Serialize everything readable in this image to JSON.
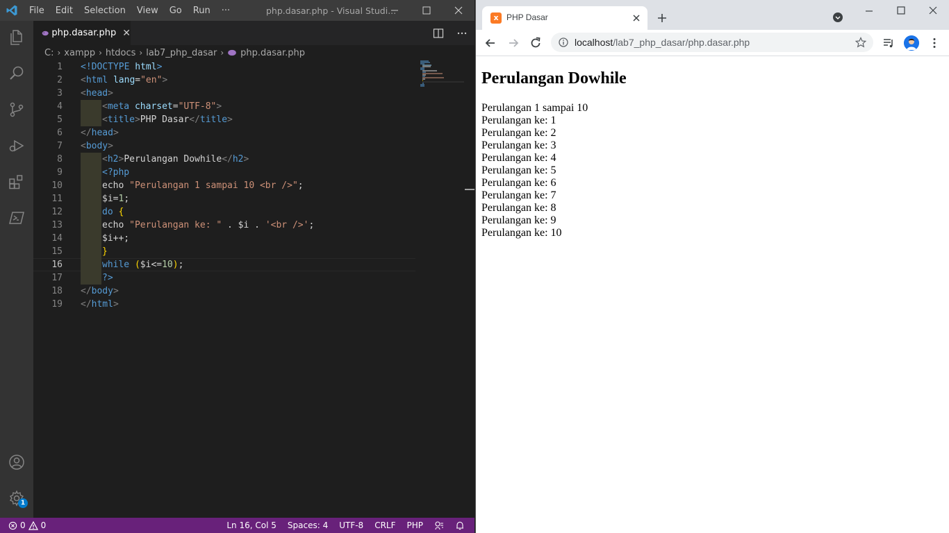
{
  "vscode": {
    "menu": [
      "File",
      "Edit",
      "Selection",
      "View",
      "Go",
      "Run",
      "···"
    ],
    "window_title": "php.dasar.php - Visual Studi...",
    "tab": {
      "label": "php.dasar.php",
      "close": "✕"
    },
    "breadcrumb": [
      "C:",
      "xampp",
      "htdocs",
      "lab7_php_dasar",
      "php.dasar.php"
    ],
    "active_line": 16,
    "settings_badge": "1",
    "status": {
      "errors": "0",
      "warnings": "0",
      "position": "Ln 16, Col 5",
      "spaces": "Spaces: 4",
      "encoding": "UTF-8",
      "eol": "CRLF",
      "language": "PHP"
    }
  },
  "code": [
    {
      "n": "1",
      "indent": 0,
      "tokens": [
        [
          "tag",
          "<!"
        ],
        [
          "tag",
          "DOCTYPE"
        ],
        [
          "plain",
          " "
        ],
        [
          "attr",
          "html"
        ],
        [
          "tag",
          ">"
        ]
      ]
    },
    {
      "n": "2",
      "indent": 0,
      "tokens": [
        [
          "gray",
          "<"
        ],
        [
          "tag",
          "html"
        ],
        [
          "plain",
          " "
        ],
        [
          "attr",
          "lang"
        ],
        [
          "plain",
          "="
        ],
        [
          "str",
          "\"en\""
        ],
        [
          "gray",
          ">"
        ]
      ]
    },
    {
      "n": "3",
      "indent": 0,
      "tokens": [
        [
          "gray",
          "<"
        ],
        [
          "tag",
          "head"
        ],
        [
          "gray",
          ">"
        ]
      ]
    },
    {
      "n": "4",
      "indent": 1,
      "tokens": [
        [
          "gray",
          "<"
        ],
        [
          "tag",
          "meta"
        ],
        [
          "plain",
          " "
        ],
        [
          "attr",
          "charset"
        ],
        [
          "plain",
          "="
        ],
        [
          "str",
          "\"UTF-8\""
        ],
        [
          "gray",
          ">"
        ]
      ]
    },
    {
      "n": "5",
      "indent": 1,
      "tokens": [
        [
          "gray",
          "<"
        ],
        [
          "tag",
          "title"
        ],
        [
          "gray",
          ">"
        ],
        [
          "plain",
          "PHP Dasar"
        ],
        [
          "gray",
          "</"
        ],
        [
          "tag",
          "title"
        ],
        [
          "gray",
          ">"
        ]
      ]
    },
    {
      "n": "6",
      "indent": 0,
      "tokens": [
        [
          "gray",
          "</"
        ],
        [
          "tag",
          "head"
        ],
        [
          "gray",
          ">"
        ]
      ]
    },
    {
      "n": "7",
      "indent": 0,
      "tokens": [
        [
          "gray",
          "<"
        ],
        [
          "tag",
          "body"
        ],
        [
          "gray",
          ">"
        ]
      ]
    },
    {
      "n": "8",
      "indent": 1,
      "tokens": [
        [
          "gray",
          "<"
        ],
        [
          "tag",
          "h2"
        ],
        [
          "gray",
          ">"
        ],
        [
          "plain",
          "Perulangan Dowhile"
        ],
        [
          "gray",
          "</"
        ],
        [
          "tag",
          "h2"
        ],
        [
          "gray",
          ">"
        ]
      ]
    },
    {
      "n": "9",
      "indent": 1,
      "tokens": [
        [
          "tag",
          "<?php"
        ]
      ]
    },
    {
      "n": "10",
      "indent": 1,
      "tokens": [
        [
          "plain",
          "echo "
        ],
        [
          "str",
          "\"Perulangan 1 sampai 10 <br />\""
        ],
        [
          "plain",
          ";"
        ]
      ]
    },
    {
      "n": "11",
      "indent": 1,
      "tokens": [
        [
          "plain",
          "$i="
        ],
        [
          "num",
          "1"
        ],
        [
          "plain",
          ";"
        ]
      ]
    },
    {
      "n": "12",
      "indent": 1,
      "tokens": [
        [
          "kw",
          "do"
        ],
        [
          "plain",
          " "
        ],
        [
          "br",
          "{"
        ]
      ]
    },
    {
      "n": "13",
      "indent": 1,
      "tokens": [
        [
          "plain",
          "echo "
        ],
        [
          "str",
          "\"Perulangan ke: \""
        ],
        [
          "plain",
          " . $i . "
        ],
        [
          "str",
          "'<br />'"
        ],
        [
          "plain",
          ";"
        ]
      ]
    },
    {
      "n": "14",
      "indent": 1,
      "tokens": [
        [
          "plain",
          "$i++;"
        ]
      ]
    },
    {
      "n": "15",
      "indent": 1,
      "tokens": [
        [
          "br",
          "}"
        ]
      ]
    },
    {
      "n": "16",
      "indent": 1,
      "tokens": [
        [
          "kw",
          "while"
        ],
        [
          "plain",
          " "
        ],
        [
          "br",
          "("
        ],
        [
          "plain",
          "$i<="
        ],
        [
          "num",
          "10"
        ],
        [
          "br",
          ")"
        ],
        [
          "plain",
          ";"
        ]
      ]
    },
    {
      "n": "17",
      "indent": 1,
      "tokens": [
        [
          "tag",
          "?>"
        ]
      ]
    },
    {
      "n": "18",
      "indent": 0,
      "tokens": [
        [
          "gray",
          "</"
        ],
        [
          "tag",
          "body"
        ],
        [
          "gray",
          ">"
        ]
      ]
    },
    {
      "n": "19",
      "indent": 0,
      "tokens": [
        [
          "gray",
          "</"
        ],
        [
          "tag",
          "html"
        ],
        [
          "gray",
          ">"
        ]
      ]
    }
  ],
  "chrome": {
    "tab_title": "PHP Dasar",
    "favicon_letter": "x",
    "url_host": "localhost",
    "url_path": "/lab7_php_dasar/php.dasar.php",
    "page": {
      "heading": "Perulangan Dowhile",
      "lines": [
        "Perulangan 1 sampai 10",
        "Perulangan ke: 1",
        "Perulangan ke: 2",
        "Perulangan ke: 3",
        "Perulangan ke: 4",
        "Perulangan ke: 5",
        "Perulangan ke: 6",
        "Perulangan ke: 7",
        "Perulangan ke: 8",
        "Perulangan ke: 9",
        "Perulangan ke: 10"
      ]
    }
  },
  "colors": {
    "statusbar": "#68217a",
    "vscode_blue": "#007acc",
    "xampp_orange": "#fb7a24"
  }
}
